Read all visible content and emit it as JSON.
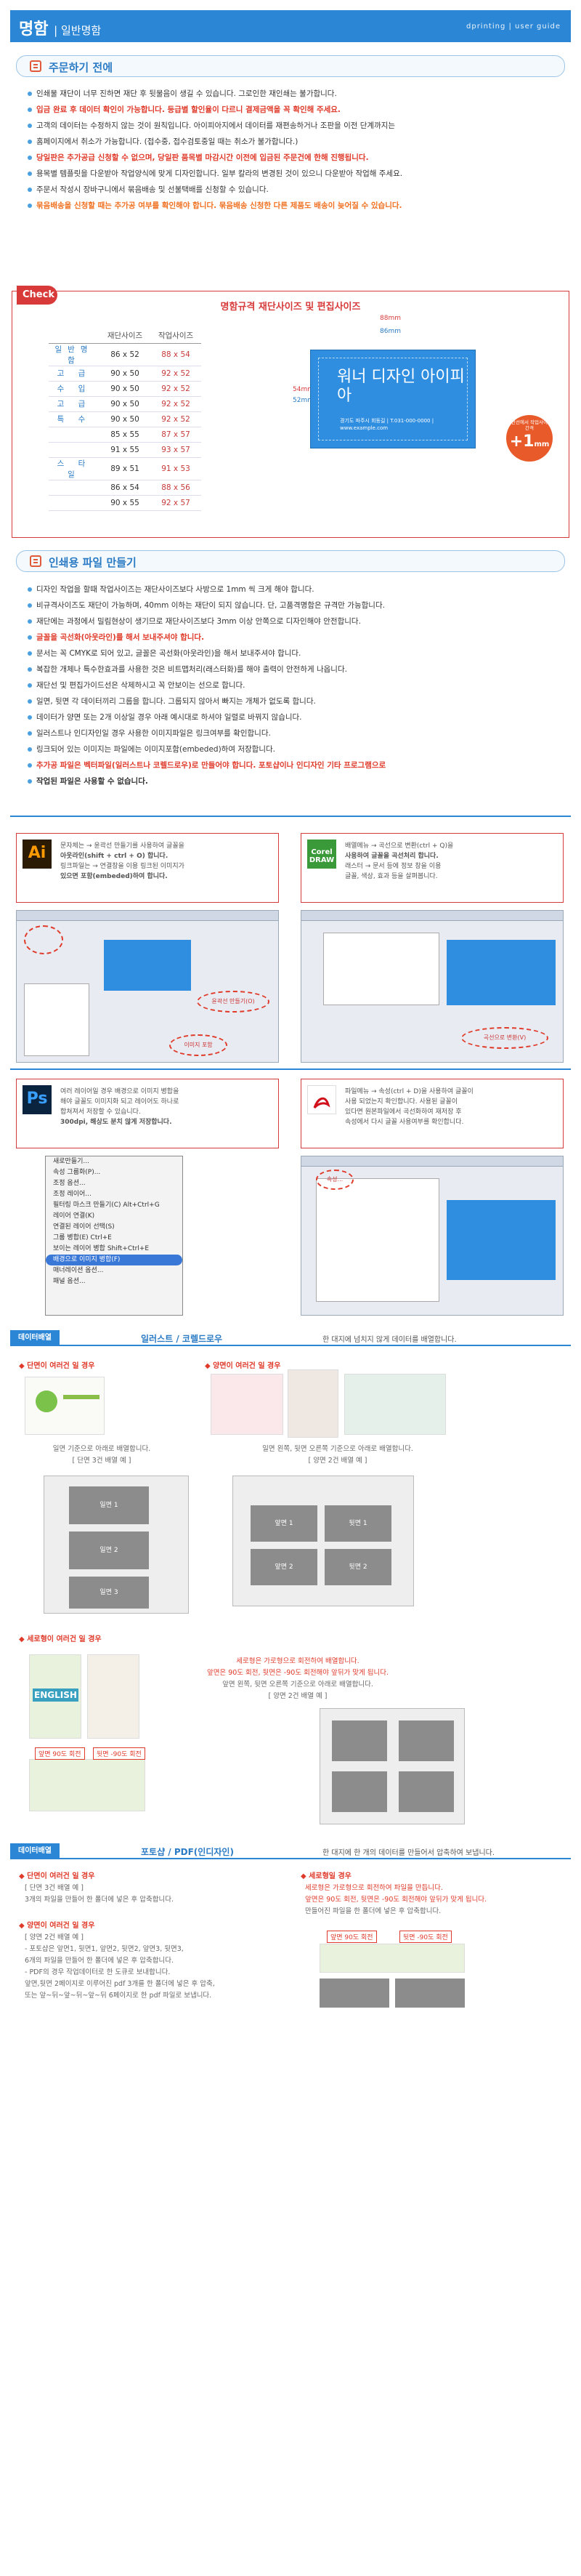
{
  "header": {
    "title": "명함",
    "subtitle": "| 일반명함",
    "right": "dprinting  |  user guide"
  },
  "sec1": {
    "title": "주문하기 전에",
    "items": [
      "인쇄물 재단이 너무 진하면 재단 후 뒷물음이 생길 수 있습니다. 그로인한 재인쇄는 불가합니다.",
      "입금 완료 후 데이터 확인이 가능합니다. 등급별 할인율이 다르니 결제금액을 꼭 확인해 주세요.",
      "고객의 데이터는 수정하지 않는 것이 원칙입니다. 아이피아지에서 데이터를 재편송하거나 조판을 이전 단계까지는",
      "홈페이지에서 취소가 가능합니다.  (접수중, 접수검토중일 때는 취소가 불가합니다.)",
      "당일판은 추가공급 신청할 수 없으며, 당일판 품목별 마감시간 이전에 입금된 주문건에 한해 진행됩니다.",
      "용목별 템플릿을 다운받아 작업양식에 맞게 디자인합니다. 일부 칼라의 변경된 것이 있으니 다운받아 작업해 주세요.",
      "주문서 작성시 장바구니에서 묶음배송 및 선불택배를 신청할 수 있습니다.",
      "묶음배송을 신청할 때는 추가공 여부를 확인해야 합니다. 묶음배송 신청한 다른 제품도 배송이 늦어질 수 있습니다."
    ]
  },
  "check": {
    "tag": "Check",
    "title": "명함규격 재단사이즈 및 편집사이즈",
    "col1": "재단사이즈",
    "col2": "작업사이즈",
    "rows": [
      {
        "cat": "일반명함",
        "cut": "86 x 52",
        "work": "88 x 54"
      },
      {
        "cat": "고 급",
        "cut": "90 x 50",
        "work": "92 x 52"
      },
      {
        "cat": "수 입",
        "cut": "90 x 50",
        "work": "92 x 52"
      },
      {
        "cat": "고 급",
        "cut": "90 x 50",
        "work": "92 x 52"
      },
      {
        "cat": "특 수",
        "cut": "90 x 50",
        "work": "92 x 52"
      },
      {
        "cat": "",
        "cut": "85 x 55",
        "work": "87 x 57"
      },
      {
        "cat": "",
        "cut": "91 x 55",
        "work": "93 x 57"
      },
      {
        "cat": "스 타 일",
        "cut": "89 x 51",
        "work": "91 x 53"
      },
      {
        "cat": "",
        "cut": "86 x 54",
        "work": "88 x 56"
      },
      {
        "cat": "",
        "cut": "90 x 55",
        "work": "92 x 57"
      }
    ],
    "dim_88": "88mm",
    "dim_86": "86mm",
    "dim_54": "54mm",
    "dim_52": "52mm",
    "card_name": "워너 디자인 아이피아",
    "card_info": "경기도 파주시 회동길 | T.031-000-0000 | www.example.com",
    "plus_note": "재단선에서 작업사이즈 간격",
    "plus_value": "+1",
    "plus_unit": "mm"
  },
  "sec2": {
    "title": "인쇄용 파일 만들기",
    "items": [
      "디자인 작업을 할때 작업사이즈는 재단사이즈보다 사방으로 1mm 씩 크게 해야 합니다.",
      "비규격사이즈도 재단이 가능하며, 40mm 이하는 재단이 되지 않습니다. 단, 고품격명함은 규격만 가능합니다.",
      "재단에는 과정에서 밀림현상이 생기므로 재단사이즈보다 3mm 이상 안쪽으로 디자인해야 안전합니다.",
      "글꼴을 곡선화(아웃라인)를 해서 보내주셔야 합니다.",
      "문서는 꼭 CMYK로 되어 있고, 글꼴은 곡선화(아웃라인)을 해서 보내주셔야 합니다.",
      "복잡한 개체나 특수한효과를 사용한 것은 비트맵처리(래스터화)를 해야 출력이 안전하게 나옵니다.",
      "재단선 및 편집가이드선은 삭제하시고 꼭 안보이는 선으로 합니다.",
      "일면, 뒷면 각 데이터끼리 그룹을 합니다. 그룹되지 않아서 빠지는 개체가 없도록 합니다.",
      "데이터가 양면 또는 2개 이상일 경우 아래 예시대로 하셔야 일렬로 바꿔지 않습니다.",
      "일러스트나 인디자인일 경우 사용한 이미지파일은 링크여부를 확인합니다.",
      "링크되어 있는 이미지는 파일에는 이미지포함(embeded)하여 저장합니다.",
      "추가공 파일은 벡터파일(일러스트나 코렐드로우)로 만들어야 합니다.  포토샵이나 인디자인 기타 프로그램으로",
      "작업된 파일은 사용할 수 없습니다."
    ]
  },
  "ai": {
    "logo": "Ai",
    "items": [
      "문자체는 → 윤곽선 만들기를 사용하여 글꼴을",
      "아웃라인(shift + ctrl + O) 합니다.",
      "링크파일는 → 연결창을 이용 링크된 이미지가",
      "있으면 포함(embeded)하여 합니다."
    ],
    "oval_outline": "윤곽선 만들기(O)",
    "oval_embed": "이미지 포함"
  },
  "cdr": {
    "logo": "Corel DRAW",
    "items": [
      "배열메뉴 → 곡선으로 변환(ctrl + Q)을",
      "사용하여 글꼴을 곡선처리 합니다.",
      "래스터 → 문서 등에 정보 창을 이용",
      "글꼴, 색상, 효과 등을 살펴봅니다."
    ],
    "oval_curve": "곡선으로 변환(V)"
  },
  "ps": {
    "logo": "Ps",
    "items": [
      "여러 레이어일 경우 배경으로 이미지 병합을",
      "해야 글꼴도 이미지화 되고 레이어도 하나로",
      "합쳐져서 저장할 수 있습니다.",
      "300dpi, 해상도 분치 않게 저장합니다."
    ],
    "menu": [
      "새로만들기...",
      "속성 그룹화(P)...",
      "조정 옵션...",
      "조정 레이어...",
      "필터링 마스크 만들기(C)   Alt+Ctrl+G",
      "레이어 연결(K)",
      "연결된 레이어 선택(S)",
      "그룹 병합(E)          Ctrl+E",
      "보이는 레이어 병합   Shift+Ctrl+E",
      "배경으로 이미지 병합(F)",
      "매너레이션 옵션...",
      "패널 옵션..."
    ]
  },
  "pdf": {
    "items": [
      "파일메뉴 → 속성(ctrl + D)을 사용하여 글꼴이",
      "사용 되었는지 확인합니다. 사용된 글꼴이",
      "있다면 원본파일에서 곡선화하여 재저장 후",
      "속성에서 다시 글꼴 사용여부를 확인합니다."
    ],
    "oval_prop": "속성..."
  },
  "data1": {
    "label": "데이터배열",
    "mid": "일러스트 / 코렐드로우",
    "right": "한 대지에 넘치지 않게 데이터를 배열합니다.",
    "case_single": "◆ 단면이 여러건 일 경우",
    "case_double": "◆ 양면이 여러건 일 경우",
    "cap_single": "일면 기준으로 아래로 배열합니다.",
    "cap_single_ex": "[ 단면 3건 배열 예 ]",
    "cap_double_1": "일면 왼쪽, 뒷면 오른쪽 기준으로 아래로 배열합니다.",
    "cap_double_ex": "[ 양면 2건 배열 예 ]",
    "slot1": "일면 1",
    "slot2": "일면 2",
    "slot3": "일면 3",
    "slotF1": "앞면 1",
    "slotB1": "뒷면 1",
    "slotF2": "앞면 2",
    "slotB2": "뒷면 2",
    "case_vertical": "◆ 세로형이 여러건 일 경우",
    "vert_cap": [
      "세로형은 가로형으로 회전하여 배열합니다.",
      "앞면은 90도 회전, 뒷면은 -90도 회전해야 앞뒤가 맞게 됩니다.",
      "앞면 왼쪽, 뒷면 오른쪽 기준으로 아래로 배열합니다.",
      "[ 양면 2건 배열 예 ]"
    ],
    "rot_front": "앞면 90도 회전",
    "rot_back": "뒷면 -90도 회전",
    "english": "ENGLISH"
  },
  "data2": {
    "label": "데이터배열",
    "mid": "포토샵 / PDF(인디자인)",
    "right": "한 대지에 한 개의 데이터를 만들어서 압축하여 보냅니다.",
    "case_single": "◆ 단면이 여러건 일 경우",
    "single_lines": [
      "[ 단면 3건 배열 예 ]",
      "3개의 파일을 만들어 한 폴더에 넣은 후 압축합니다."
    ],
    "case_double": "◆ 양면이 여러건 일 경우",
    "double_lines": [
      "[ 양면 2건 배열 예 ]",
      "- 포토샵은 앞면1, 뒷면1, 앞면2, 뒷면2, 앞면3, 뒷면3,",
      "6개의 파일을 만들어 한 폴더에 넣은 후 압축합니다.",
      "- PDF의 경우 작업데이터로 한 도큐로 보내합니다.",
      "앞면,뒷면 2페이지로 이루어진 pdf 3개를 한 폴더에 넣은 후 압축,",
      "또는 앞~뒤~앞~뒤~앞~뒤 6페이지로 한 pdf 파일로 보냅니다."
    ],
    "case_vertical": "◆ 세로형일 경우",
    "vert_lines": [
      "세로형은 가로형으로 회전하여 파일을 만듭니다.",
      "앞면은 90도 회전, 뒷면은 -90도 회전해야 앞뒤가 맞게 됩니다.",
      "만들어진 파일을 한 폴더에 넣은 후 압축합니다."
    ],
    "rot_front": "앞면 90도 회전",
    "rot_back": "뒷면 -90도 회전"
  },
  "colors": {
    "accent": "#2b86d6",
    "red": "#d83a3a"
  }
}
